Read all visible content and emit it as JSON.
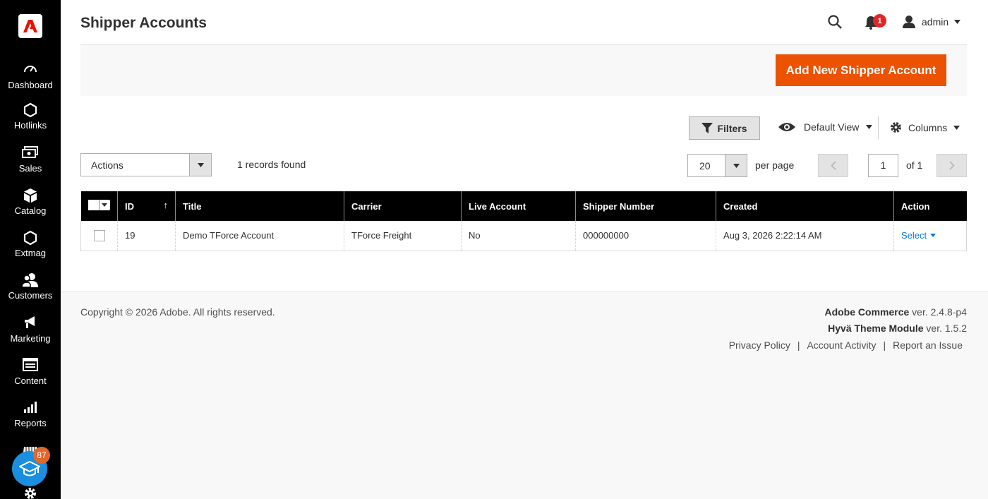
{
  "sidebar": {
    "items": [
      {
        "label": "Dashboard",
        "icon": "dashboard-icon"
      },
      {
        "label": "Hotlinks",
        "icon": "hexagon-icon"
      },
      {
        "label": "Sales",
        "icon": "sales-icon"
      },
      {
        "label": "Catalog",
        "icon": "catalog-icon"
      },
      {
        "label": "Extmag",
        "icon": "hexagon-icon"
      },
      {
        "label": "Customers",
        "icon": "customers-icon"
      },
      {
        "label": "Marketing",
        "icon": "megaphone-icon"
      },
      {
        "label": "Content",
        "icon": "content-icon"
      },
      {
        "label": "Reports",
        "icon": "bar-chart-icon"
      }
    ],
    "fab_badge": "87"
  },
  "header": {
    "title": "Shipper Accounts",
    "notification_count": "1",
    "user": "admin"
  },
  "toolbar": {
    "add_label": "Add New Shipper Account"
  },
  "grid_controls": {
    "filters_label": "Filters",
    "view_label": "Default View",
    "columns_label": "Columns",
    "actions_label": "Actions",
    "records_found": "1 records found",
    "per_page_value": "20",
    "per_page_label": "per page",
    "page_value": "1",
    "page_of": "of 1"
  },
  "table": {
    "columns": [
      "ID",
      "Title",
      "Carrier",
      "Live Account",
      "Shipper Number",
      "Created",
      "Action"
    ],
    "rows": [
      {
        "id": "19",
        "title": "Demo TForce Account",
        "carrier": "TForce Freight",
        "live": "No",
        "shipper_number": "000000000",
        "created": "Aug 3, 2026 2:22:14 AM",
        "action": "Select"
      }
    ]
  },
  "footer": {
    "copyright": "Copyright © 2026 Adobe. All rights reserved.",
    "product1_name": "Adobe Commerce",
    "product1_ver": " ver. 2.4.8-p4",
    "product2_name": "Hyvä Theme Module",
    "product2_ver": " ver. 1.5.2",
    "links": [
      "Privacy Policy",
      "Account Activity",
      "Report an Issue"
    ]
  },
  "colors": {
    "accent": "#eb5202",
    "link": "#007bdb",
    "sidebar_bg": "#000000"
  }
}
